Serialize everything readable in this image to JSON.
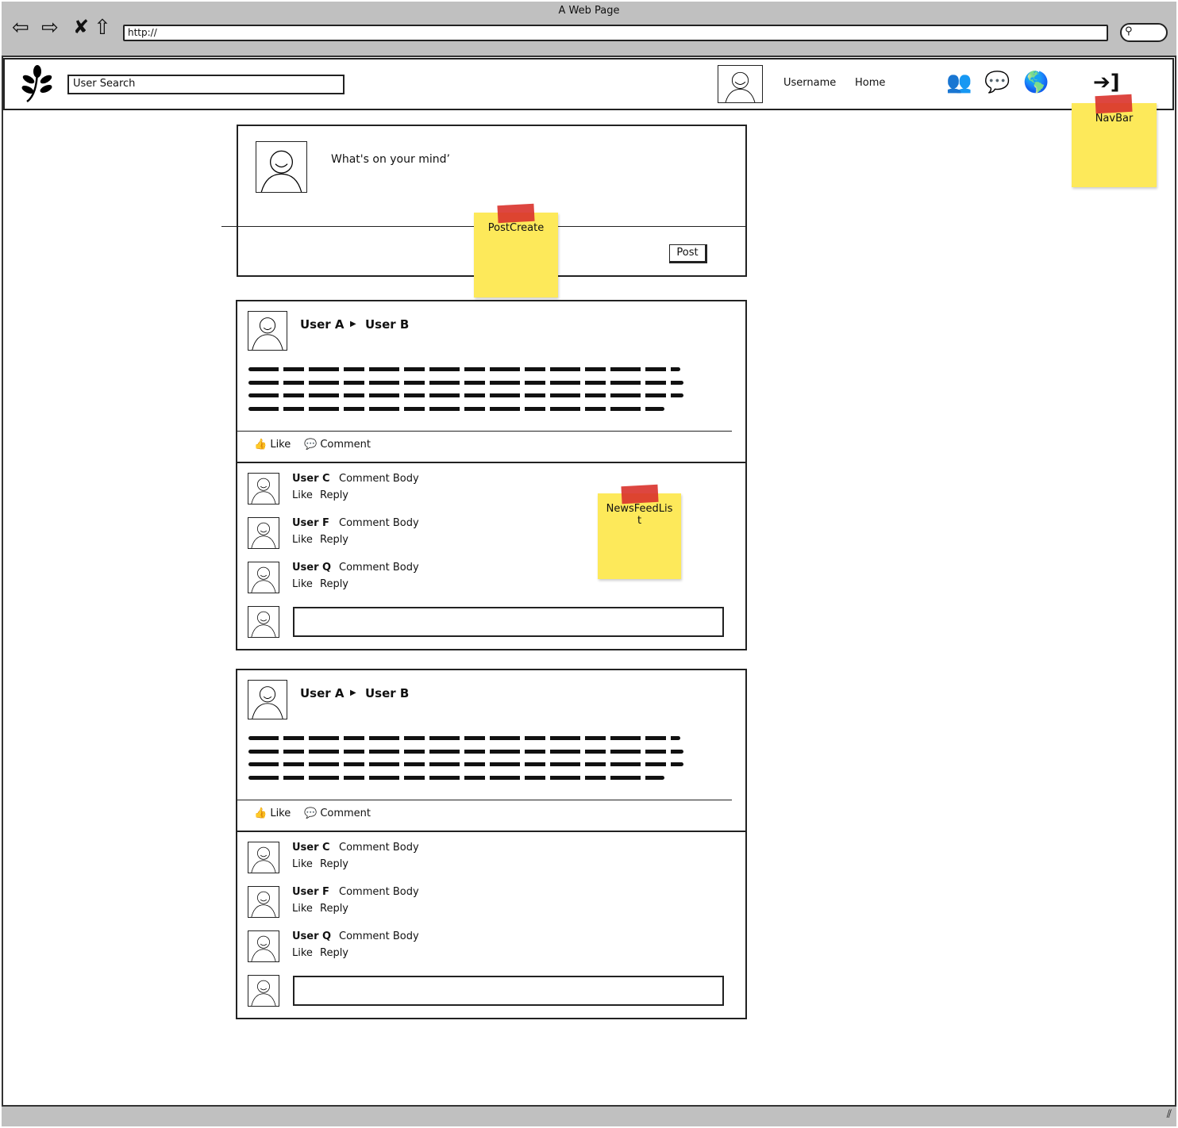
{
  "browser": {
    "title": "A Web Page",
    "url": "http://"
  },
  "navbar": {
    "search_value": "User Search",
    "username": "Username",
    "home": "Home",
    "icons": [
      "friends-icon",
      "messages-icon",
      "globe-icon",
      "sign-in-icon"
    ]
  },
  "post_create": {
    "prompt": "What's on your mind’",
    "post_label": "Post"
  },
  "stickies": {
    "navbar": "NavBar",
    "post_create": "PostCreate",
    "news_feed": "NewsFeedList"
  },
  "posts": [
    {
      "author": "User A",
      "target": "User B",
      "like_label": "Like",
      "comment_label": "Comment",
      "comments": [
        {
          "user": "User C",
          "body": "Comment Body",
          "like": "Like",
          "reply": "Reply"
        },
        {
          "user": "User F",
          "body": "Comment Body",
          "like": "Like",
          "reply": "Reply"
        },
        {
          "user": "User Q",
          "body": "Comment Body",
          "like": "Like",
          "reply": "Reply"
        }
      ],
      "comment_input": ""
    },
    {
      "author": "User A",
      "target": "User B",
      "like_label": "Like",
      "comment_label": "Comment",
      "comments": [
        {
          "user": "User C",
          "body": "Comment Body",
          "like": "Like",
          "reply": "Reply"
        },
        {
          "user": "User F",
          "body": "Comment Body",
          "like": "Like",
          "reply": "Reply"
        },
        {
          "user": "User Q",
          "body": "Comment Body",
          "like": "Like",
          "reply": "Reply"
        }
      ],
      "comment_input": ""
    }
  ],
  "colors": {
    "chrome": "#c0c0c0",
    "sticky": "#fde95a",
    "tape": "#d9322b"
  }
}
